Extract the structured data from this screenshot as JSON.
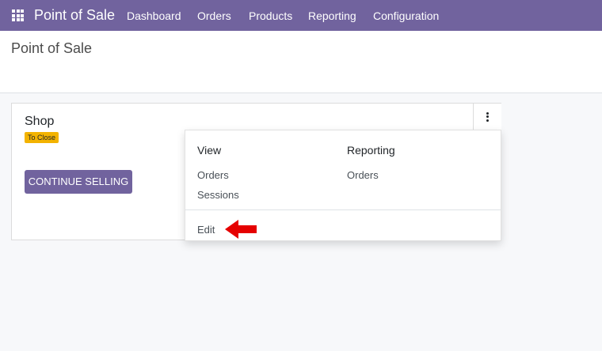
{
  "navbar": {
    "app_name": "Point of Sale",
    "menu": [
      "Dashboard",
      "Orders",
      "Products",
      "Reporting",
      "Configuration"
    ]
  },
  "page": {
    "title": "Point of Sale"
  },
  "card": {
    "shop_name": "Shop",
    "status_badge": "To Close",
    "continue_button": "CONTINUE SELLING"
  },
  "dropdown": {
    "view_header": "View",
    "view_items": [
      "Orders",
      "Sessions"
    ],
    "reporting_header": "Reporting",
    "reporting_items": [
      "Orders"
    ],
    "edit_label": "Edit"
  },
  "colors": {
    "brand": "#71639e",
    "badge": "#f3b300",
    "arrow": "#e50000"
  },
  "icons": {
    "apps": "apps-grid-icon",
    "kebab": "vertical-ellipsis-icon",
    "pointer": "red-arrow-icon"
  }
}
